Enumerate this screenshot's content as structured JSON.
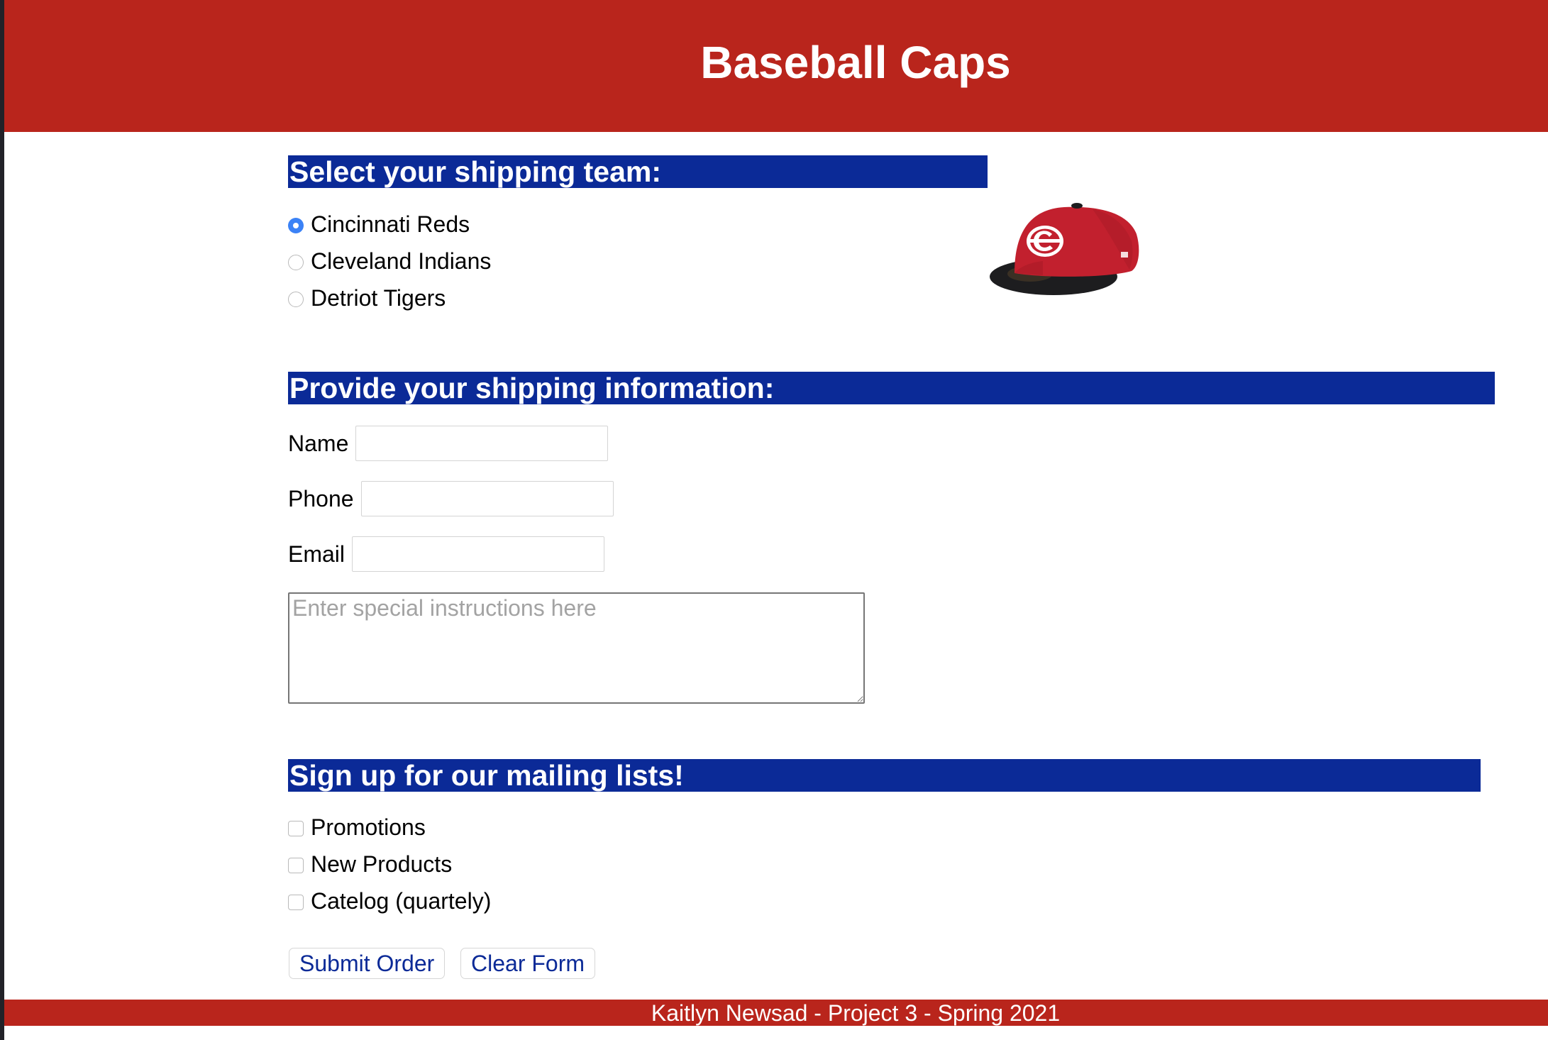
{
  "header": {
    "title": "Baseball Caps"
  },
  "team_section": {
    "heading": "Select your shipping team:",
    "selected": "Cincinnati Reds",
    "options": [
      {
        "label": "Cincinnati Reds",
        "checked": true
      },
      {
        "label": "Cleveland Indians",
        "checked": false
      },
      {
        "label": "Detriot Tigers",
        "checked": false
      }
    ],
    "image_icon": "baseball-cap-icon"
  },
  "shipping_section": {
    "heading": "Provide your shipping information:",
    "name_label": "Name",
    "name_value": "",
    "phone_label": "Phone",
    "phone_value": "",
    "email_label": "Email",
    "email_value": "",
    "instructions_placeholder": "Enter special instructions here",
    "instructions_value": ""
  },
  "mailing_section": {
    "heading": "Sign up for our mailing lists!",
    "options": [
      {
        "label": "Promotions",
        "checked": false
      },
      {
        "label": "New Products",
        "checked": false
      },
      {
        "label": "Catelog (quartely)",
        "checked": false
      }
    ]
  },
  "buttons": {
    "submit_label": "Submit Order",
    "clear_label": "Clear Form"
  },
  "footer": {
    "text": "Kaitlyn Newsad - Project 3 - Spring 2021"
  },
  "colors": {
    "header_red": "#b9251c",
    "heading_blue": "#0b2a97",
    "radio_blue": "#3b82f6"
  }
}
